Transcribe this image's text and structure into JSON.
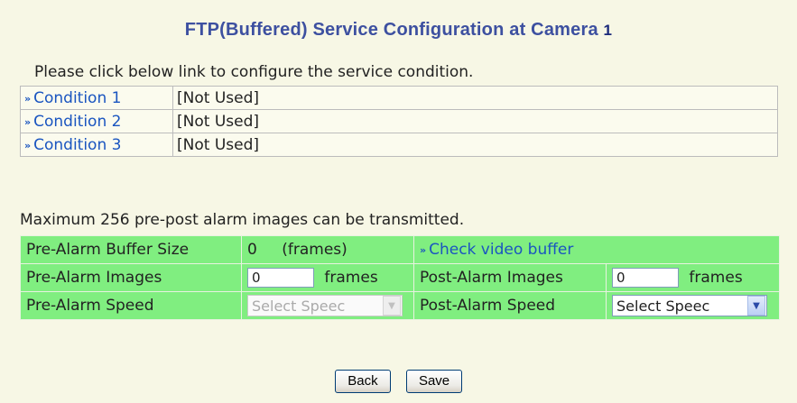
{
  "title": {
    "text": "FTP(Buffered) Service Configuration at Camera",
    "camera_number": "1"
  },
  "instruction": "Please click below link to configure the service condition.",
  "conditions": [
    {
      "label": "Condition 1",
      "status": "[Not Used]"
    },
    {
      "label": "Condition 2",
      "status": "[Not Used]"
    },
    {
      "label": "Condition 3",
      "status": "[Not Used]"
    }
  ],
  "max_message": "Maximum 256 pre-post alarm images can be transmitted.",
  "alarm": {
    "buffer_size_label": "Pre-Alarm Buffer Size",
    "buffer_size_value": "0",
    "buffer_size_unit": "(frames)",
    "check_buffer_link": "Check video buffer",
    "pre_images_label": "Pre-Alarm Images",
    "pre_images_value": "0",
    "pre_images_unit": "frames",
    "post_images_label": "Post-Alarm Images",
    "post_images_value": "0",
    "post_images_unit": "frames",
    "pre_speed_label": "Pre-Alarm Speed",
    "pre_speed_value": "Select Speec",
    "post_speed_label": "Post-Alarm Speed",
    "post_speed_value": "Select Speec"
  },
  "buttons": {
    "back": "Back",
    "save": "Save"
  },
  "icons": {
    "link_arrow": "double-chevron-right-icon",
    "dropdown": "chevron-down-icon"
  },
  "colors": {
    "title": "#3d50a0",
    "link": "#1a55c0",
    "alarm_bg": "#80ee80",
    "page_bg": "#f7f7e5"
  }
}
